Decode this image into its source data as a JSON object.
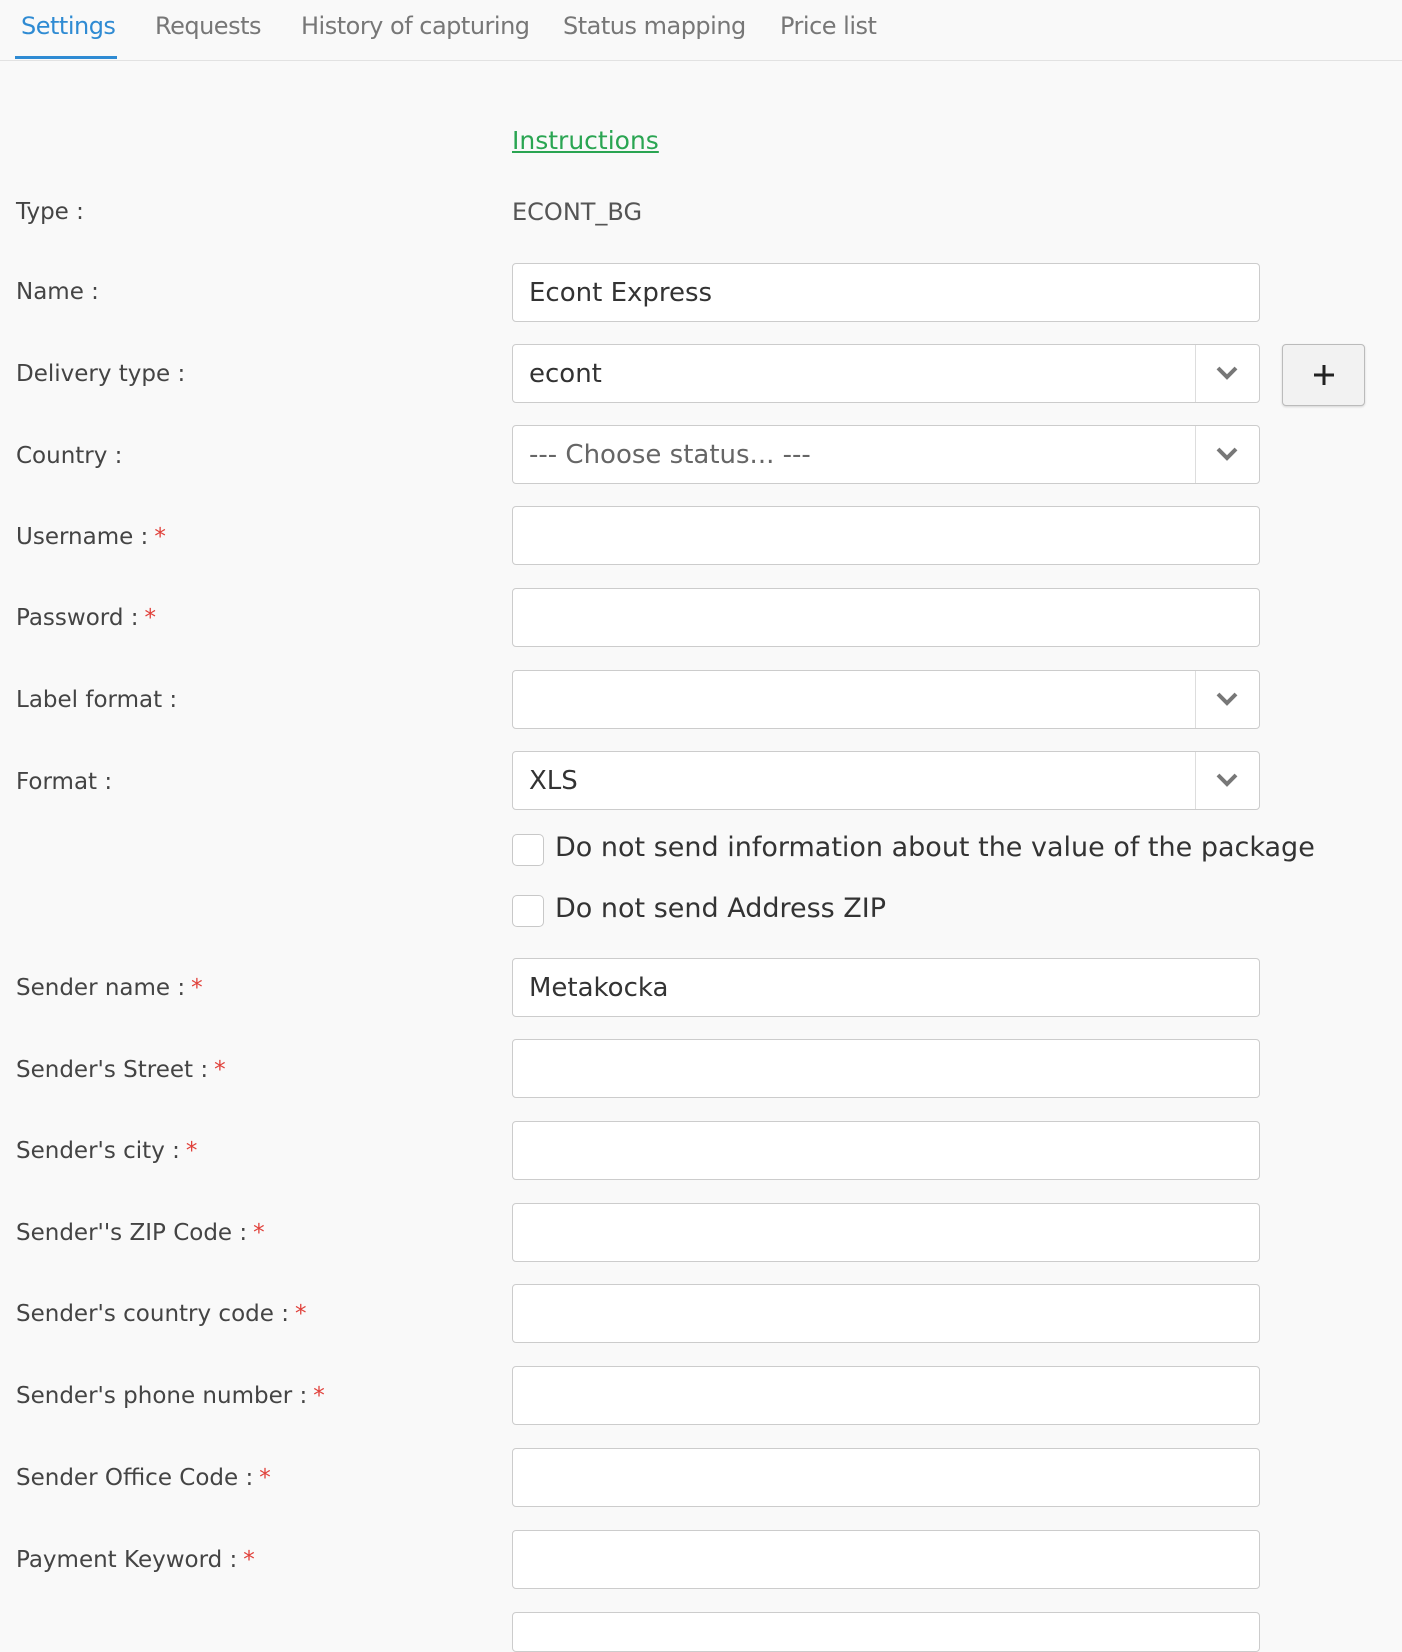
{
  "tabs": [
    {
      "label": "Settings",
      "active": true
    },
    {
      "label": "Requests"
    },
    {
      "label": "History of capturing"
    },
    {
      "label": "Status mapping"
    },
    {
      "label": "Price list"
    }
  ],
  "instructions_link": "Instructions",
  "form": {
    "type": {
      "label": "Type :",
      "value": "ECONT_BG"
    },
    "name": {
      "label": "Name :",
      "value": "Econt Express"
    },
    "delivery_type": {
      "label": "Delivery type :",
      "value": "econt"
    },
    "add_button_symbol": "+",
    "country": {
      "label": "Country :",
      "placeholder": "--- Choose status... ---"
    },
    "username": {
      "label": "Username :",
      "value": ""
    },
    "password": {
      "label": "Password :",
      "value": ""
    },
    "label_format": {
      "label": "Label format :",
      "value": ""
    },
    "format": {
      "label": "Format :",
      "value": "XLS"
    },
    "checkboxes": [
      {
        "label": "Do not send information about the value of the package",
        "checked": false
      },
      {
        "label": "Do not send Address ZIP",
        "checked": false
      }
    ],
    "sender_name": {
      "label": "Sender name :",
      "value": "Metakocka"
    },
    "sender_street": {
      "label": "Sender's Street :",
      "value": ""
    },
    "sender_city": {
      "label": "Sender's city :",
      "value": ""
    },
    "sender_zip": {
      "label": "Sender''s ZIP Code :",
      "value": ""
    },
    "sender_country_code": {
      "label": "Sender's country code :",
      "value": ""
    },
    "sender_phone": {
      "label": "Sender's phone number :",
      "value": ""
    },
    "sender_office_code": {
      "label": "Sender Office Code :",
      "value": ""
    },
    "payment_keyword": {
      "label": "Payment Keyword :",
      "value": ""
    },
    "required_marker": "*"
  },
  "colors": {
    "accent": "#2f8bd3",
    "link": "#2aa552",
    "required": "#e0403a",
    "background": "#f9f9f9"
  }
}
